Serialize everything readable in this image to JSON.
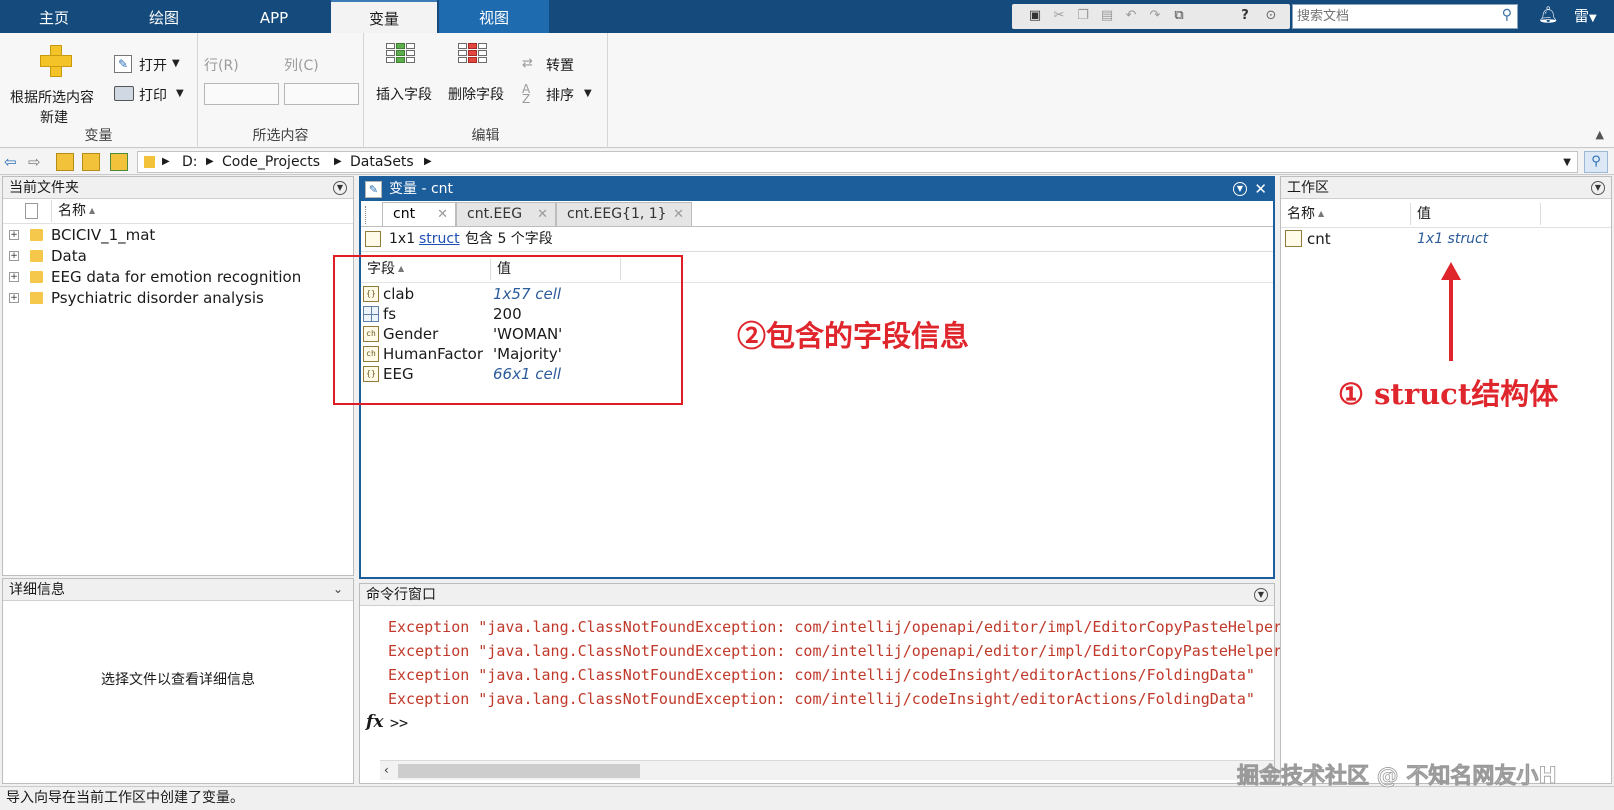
{
  "main_tabs": [
    {
      "label": "主页",
      "active": false
    },
    {
      "label": "绘图",
      "active": false
    },
    {
      "label": "APP",
      "active": false
    },
    {
      "label": "变量",
      "active": true
    },
    {
      "label": "视图",
      "active": false
    }
  ],
  "search": {
    "placeholder": "搜索文档"
  },
  "user_menu": "雷",
  "ribbon": {
    "variable": {
      "new_from_selection_line1": "根据所选内容",
      "new_from_selection_line2": "新建",
      "open_label": "打开",
      "print_label": "打印",
      "section_label": "变量"
    },
    "selection": {
      "row_label": "行(R)",
      "col_label": "列(C)",
      "row_value": "",
      "col_value": "",
      "section_label": "所选内容"
    },
    "edit": {
      "insert_field_label": "插入字段",
      "delete_field_label": "删除字段",
      "transpose_label": "转置",
      "sort_label": "排序",
      "section_label": "编辑"
    }
  },
  "address": {
    "crumbs": [
      "D:",
      "Code_Projects",
      "DataSets"
    ]
  },
  "current_folder": {
    "title": "当前文件夹",
    "column_name": "名称",
    "items": [
      "BCICIV_1_mat",
      "Data",
      "EEG data for emotion recognition",
      "Psychiatric disorder analysis"
    ]
  },
  "details": {
    "title": "详细信息",
    "empty_message": "选择文件以查看详细信息"
  },
  "variable_editor": {
    "title": "变量 - cnt",
    "tabs": [
      "cnt",
      "cnt.EEG",
      "cnt.EEG{1, 1}"
    ],
    "info_size": "1x1",
    "info_type_link": "struct",
    "info_suffix": "包含 5 个字段",
    "column_field": "字段",
    "column_value": "值",
    "fields": [
      {
        "name": "clab",
        "value": "1x57 cell",
        "icon": "cell-icon",
        "italic": true
      },
      {
        "name": "fs",
        "value": "200",
        "icon": "numeric-icon",
        "italic": false
      },
      {
        "name": "Gender",
        "value": "'WOMAN'",
        "icon": "char-icon",
        "italic": false
      },
      {
        "name": "HumanFactor",
        "value": "'Majority'",
        "icon": "char-icon",
        "italic": false
      },
      {
        "name": "EEG",
        "value": "66x1 cell",
        "icon": "cell-icon",
        "italic": true
      }
    ]
  },
  "workspace": {
    "title": "工作区",
    "column_name": "名称",
    "column_value": "值",
    "vars": [
      {
        "name": "cnt",
        "value": "1x1 struct"
      }
    ]
  },
  "command_window": {
    "title": "命令行窗口",
    "lines": [
      "Exception \"java.lang.ClassNotFoundException: com/intellij/openapi/editor/impl/EditorCopyPasteHelperImpl\"",
      "Exception \"java.lang.ClassNotFoundException: com/intellij/openapi/editor/impl/EditorCopyPasteHelperImpl\"",
      "Exception \"java.lang.ClassNotFoundException: com/intellij/codeInsight/editorActions/FoldingData\"",
      "Exception \"java.lang.ClassNotFoundException: com/intellij/codeInsight/editorActions/FoldingData\""
    ],
    "prompt": ">>",
    "fx_label": "fx"
  },
  "annotations": {
    "fields_note": "②包含的字段信息",
    "struct_note": "① struct结构体"
  },
  "status": "导入向导在当前工作区中创建了变量。",
  "watermark": "掘金技术社区 @ 不知名网友小H",
  "colors": {
    "tab_bar": "#154a7d",
    "title_bar": "#1c5d9c",
    "annotation": "#e0262d",
    "error_text": "#c0392b"
  }
}
